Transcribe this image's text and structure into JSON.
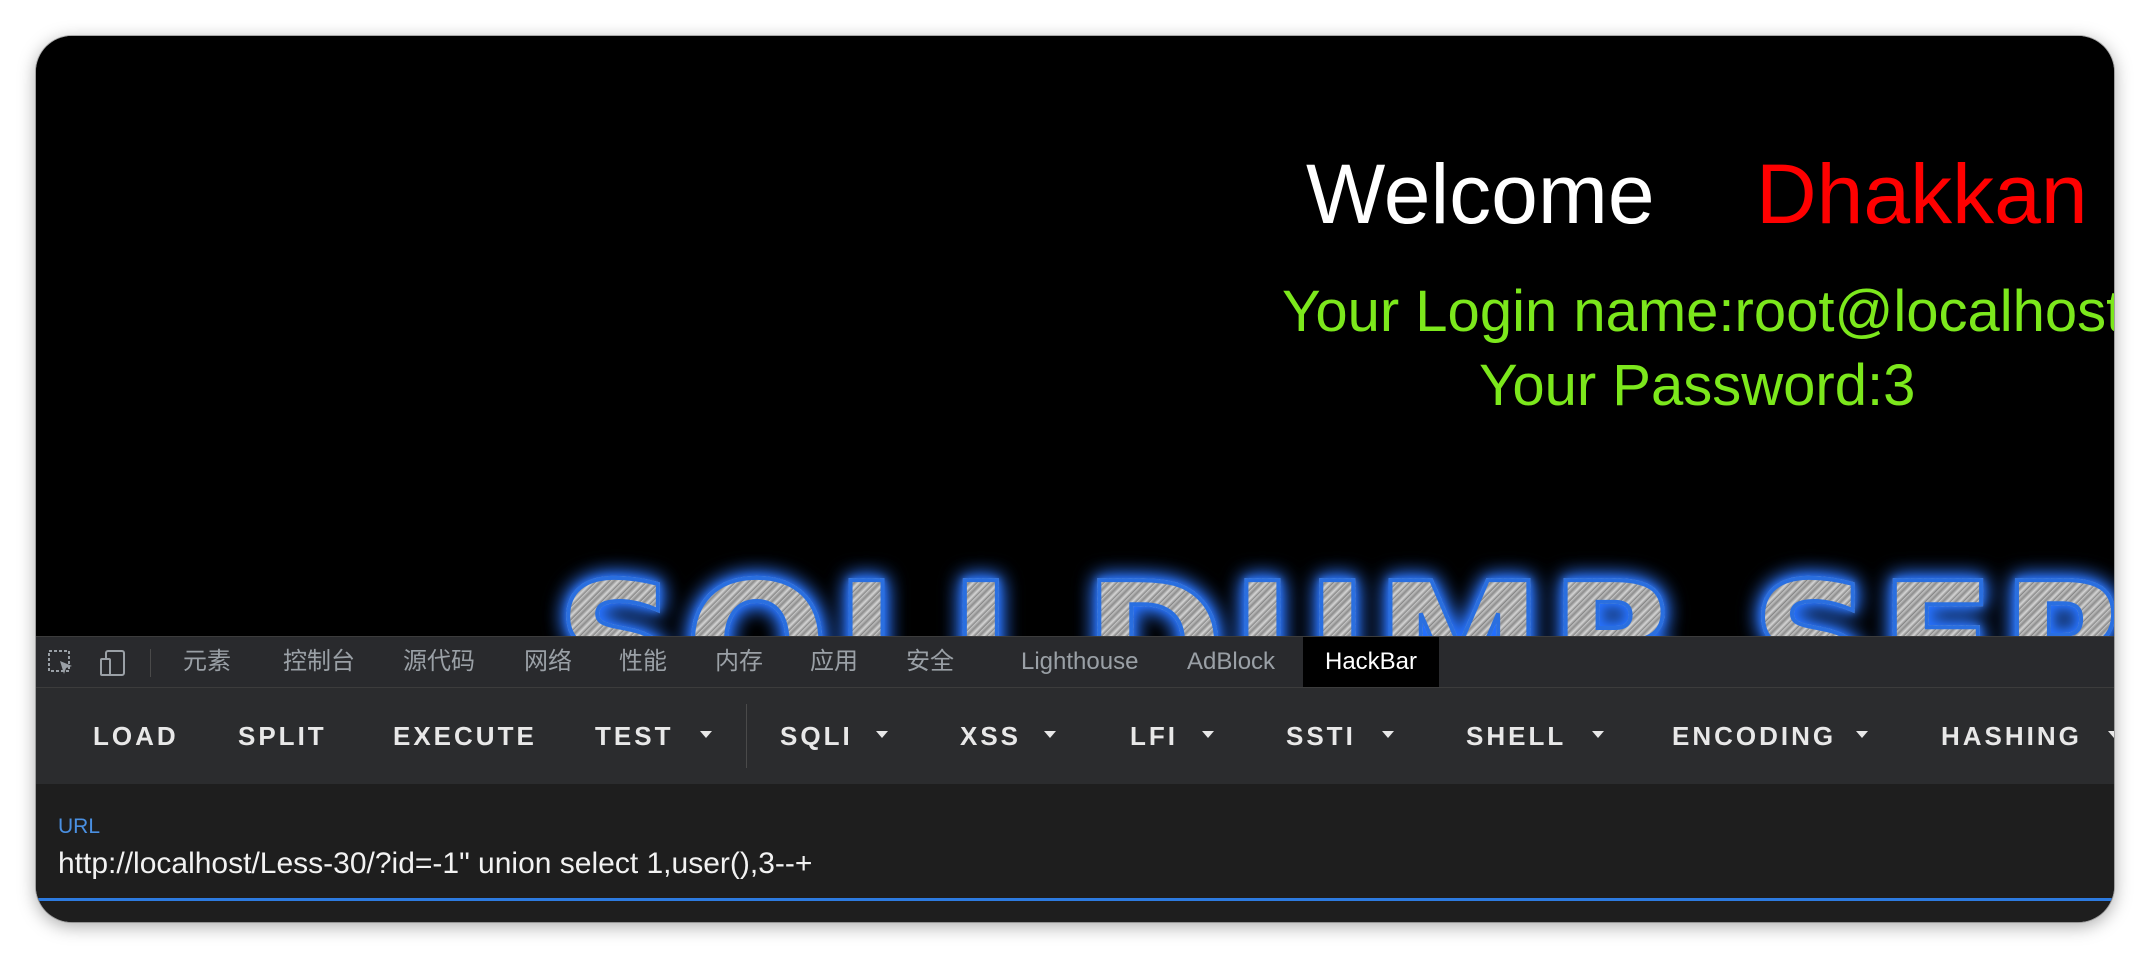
{
  "page": {
    "welcome": "Welcome",
    "username": "Dhakkan",
    "login_name": "Your Login name:root@localhost",
    "password": "Your Password:3",
    "banner": "SQLI DUMB SERIES"
  },
  "devtools": {
    "tabs": [
      {
        "label": "元素"
      },
      {
        "label": "控制台"
      },
      {
        "label": "源代码"
      },
      {
        "label": "网络"
      },
      {
        "label": "性能"
      },
      {
        "label": "内存"
      },
      {
        "label": "应用"
      },
      {
        "label": "安全"
      },
      {
        "label": "Lighthouse"
      },
      {
        "label": "AdBlock"
      },
      {
        "label": "HackBar",
        "active": true
      }
    ],
    "icons": [
      "inspect-element-icon",
      "device-toolbar-icon"
    ]
  },
  "hackbar": {
    "buttons": [
      {
        "label": "LOAD"
      },
      {
        "label": "SPLIT"
      },
      {
        "label": "EXECUTE"
      },
      {
        "label": "TEST",
        "dropdown": true
      },
      {
        "label": "SQLI",
        "dropdown": true
      },
      {
        "label": "XSS",
        "dropdown": true
      },
      {
        "label": "LFI",
        "dropdown": true
      },
      {
        "label": "SSTI",
        "dropdown": true
      },
      {
        "label": "SHELL",
        "dropdown": true
      },
      {
        "label": "ENCODING",
        "dropdown": true
      },
      {
        "label": "HASHING",
        "dropdown": true
      }
    ],
    "url_label": "URL",
    "url_value": "http://localhost/Less-30/?id=-1\" union select 1,user(),3--+"
  },
  "colors": {
    "welcome": "#ffffff",
    "username": "#ff0000",
    "login_info": "#7ce81c",
    "accent": "#2d7be0"
  }
}
